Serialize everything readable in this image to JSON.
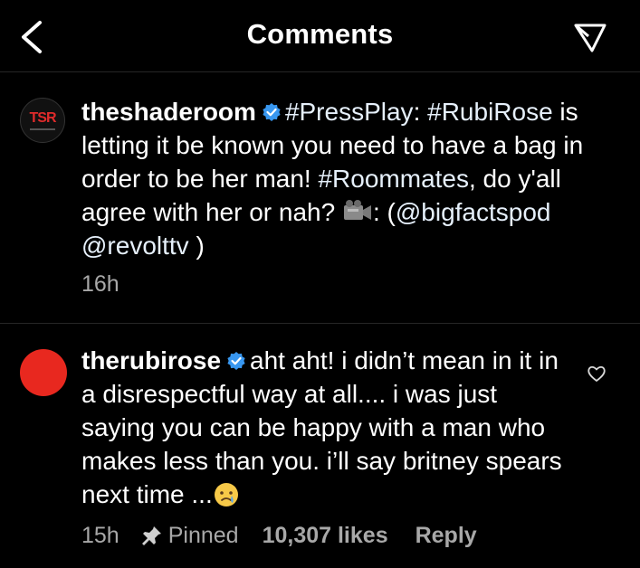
{
  "header": {
    "title": "Comments",
    "back_icon": "chevron-left-icon",
    "send_icon": "paper-plane-icon"
  },
  "caption": {
    "username": "theshaderoom",
    "avatar_text": "TSR",
    "parts": {
      "p1": "#PressPlay",
      "p2": ": ",
      "p3": "#RubiRose",
      "p4": " is letting it be known you need to have a bag in order to be her man! ",
      "p5": "#Roommates",
      "p6": ", do y'all agree with her or nah? ",
      "p7": ": (",
      "p8": "@bigfactspod",
      "p9": " ",
      "p10": "@revolttv",
      "p11": " )"
    },
    "time": "16h"
  },
  "comment": {
    "username": "therubirose",
    "text": "aht aht! i didn’t mean in it in a disrespectful way at all.... i was just saying you can be happy with a man who makes less than you. i’ll say britney spears next time ...",
    "time": "15h",
    "pinned_label": "Pinned",
    "likes": "10,307 likes",
    "reply_label": "Reply",
    "avatar_color": "#e8281f"
  },
  "colors": {
    "background": "#000000",
    "text": "#ffffff",
    "secondary": "#a8a8a8",
    "verified": "#3897f0"
  }
}
